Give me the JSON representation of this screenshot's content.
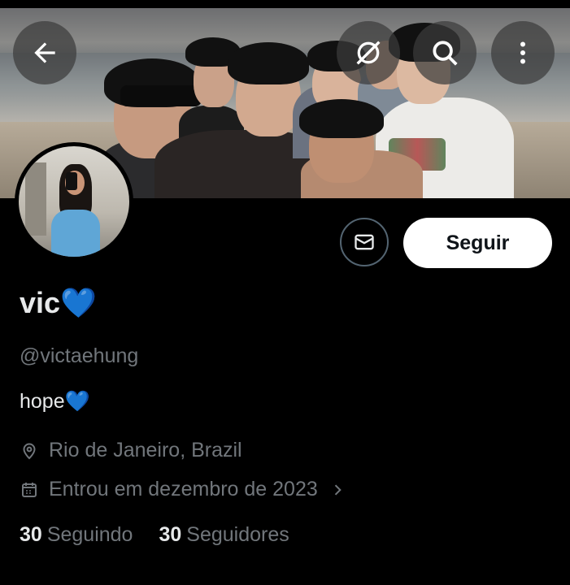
{
  "header": {
    "back_icon": "arrow-left-icon",
    "grok_icon": "grok-icon",
    "search_icon": "search-icon",
    "more_icon": "more-vertical-icon"
  },
  "profile": {
    "display_name": "vic💙",
    "handle": "@victaehung",
    "bio": "hope💙",
    "location": "Rio de Janeiro, Brazil",
    "joined": "Entrou em dezembro de 2023",
    "following_count": "30",
    "following_label": "Seguindo",
    "followers_count": "30",
    "followers_label": "Seguidores"
  },
  "actions": {
    "follow_label": "Seguir",
    "message_icon": "mail-icon"
  },
  "colors": {
    "background": "#000000",
    "text_primary": "#e7e9ea",
    "text_secondary": "#71767b",
    "button_bg": "#ffffff",
    "heart": "#3a8ee6"
  }
}
